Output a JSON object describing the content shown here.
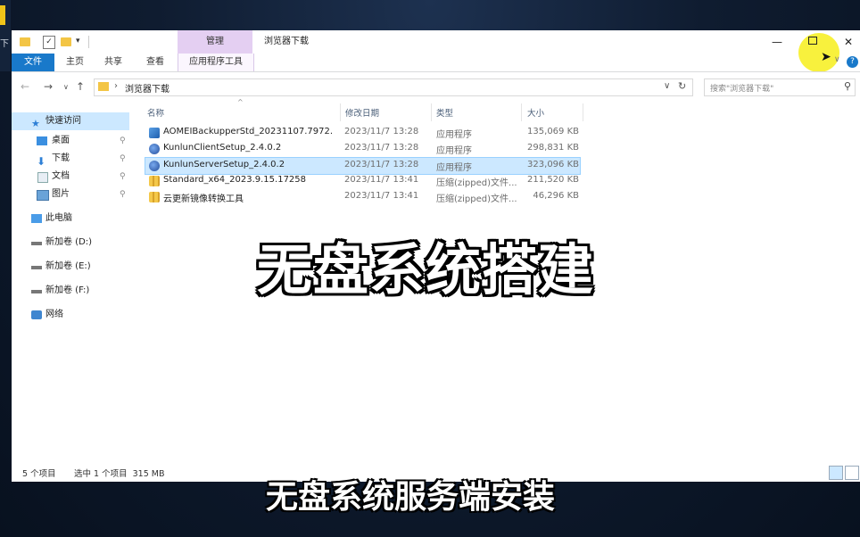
{
  "window": {
    "title": "浏览器下载",
    "context_tab": "管理",
    "quick_access_drop": "▾"
  },
  "ribbon": {
    "tabs": [
      "文件",
      "主页",
      "共享",
      "查看",
      "应用程序工具"
    ],
    "accent": "#1979ca"
  },
  "address": {
    "path": "浏览器下载",
    "search_placeholder": "搜索\"浏览器下载\""
  },
  "nav_pane": {
    "items": [
      {
        "label": "快速访问",
        "icon": "star-icon",
        "pinned": false
      },
      {
        "label": "桌面",
        "icon": "desktop-icon",
        "pinned": true
      },
      {
        "label": "下载",
        "icon": "download-icon",
        "pinned": true
      },
      {
        "label": "文档",
        "icon": "document-icon",
        "pinned": true
      },
      {
        "label": "图片",
        "icon": "picture-icon",
        "pinned": true
      },
      {
        "label": "此电脑",
        "icon": "computer-icon",
        "pinned": false
      },
      {
        "label": "新加卷 (D:)",
        "icon": "drive-icon",
        "pinned": false
      },
      {
        "label": "新加卷 (E:)",
        "icon": "drive-icon",
        "pinned": false
      },
      {
        "label": "新加卷 (F:)",
        "icon": "drive-icon",
        "pinned": false
      },
      {
        "label": "网络",
        "icon": "network-icon",
        "pinned": false
      }
    ]
  },
  "columns": [
    "名称",
    "修改日期",
    "类型",
    "大小"
  ],
  "files": [
    {
      "name": "AOMEIBackupperStd_20231107.7972...",
      "date": "2023/11/7 13:28",
      "type": "应用程序",
      "size": "135,069 KB",
      "icon": "app-icon",
      "selected": false
    },
    {
      "name": "KunlunClientSetup_2.4.0.2",
      "date": "2023/11/7 13:28",
      "type": "应用程序",
      "size": "298,831 KB",
      "icon": "app-icon",
      "selected": false
    },
    {
      "name": "KunlunServerSetup_2.4.0.2",
      "date": "2023/11/7 13:28",
      "type": "应用程序",
      "size": "323,096 KB",
      "icon": "app-icon",
      "selected": true
    },
    {
      "name": "Standard_x64_2023.9.15.17258",
      "date": "2023/11/7 13:41",
      "type": "压缩(zipped)文件...",
      "size": "211,520 KB",
      "icon": "zip-icon",
      "selected": false
    },
    {
      "name": "云更新镜像转换工具",
      "date": "2023/11/7 13:41",
      "type": "压缩(zipped)文件...",
      "size": "46,296 KB",
      "icon": "zip-icon",
      "selected": false
    }
  ],
  "status": {
    "count": "5 个项目",
    "selection": "选中 1 个项目  315 MB"
  },
  "overlay": {
    "headline": "无盘系统搭建",
    "subtitle": "无盘系统服务端安装"
  },
  "left_stub_text": "下"
}
